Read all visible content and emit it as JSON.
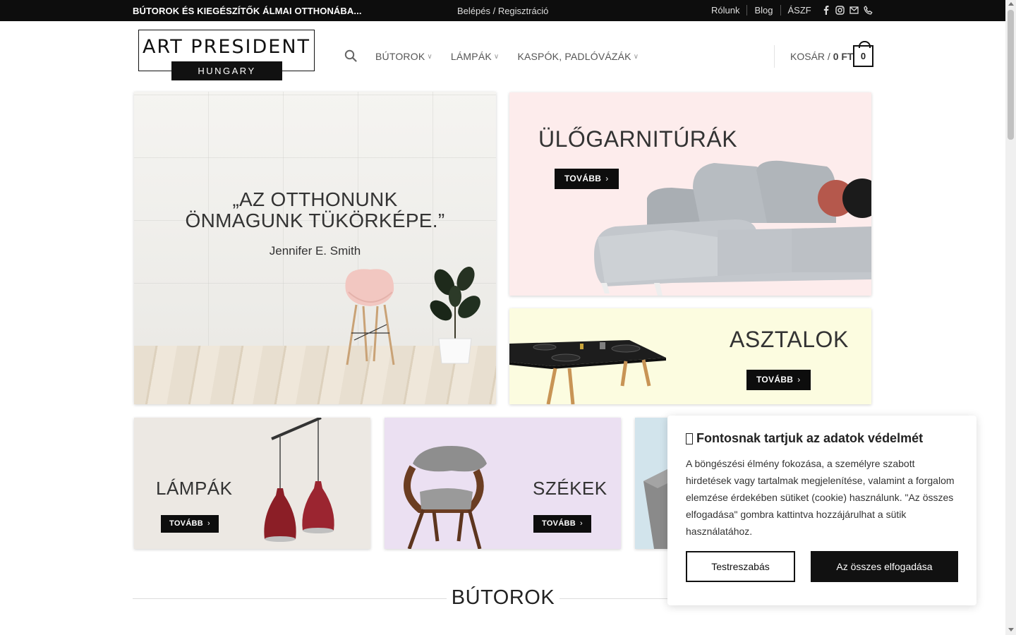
{
  "topbar": {
    "tagline": "BÚTOROK ÉS KIEGÉSZÍTŐK ÁLMAI OTTHONÁBA...",
    "login": "Belépés / Regisztráció",
    "links": [
      "Rólunk",
      "Blog",
      "ÁSZF"
    ],
    "social_icons": [
      "facebook-icon",
      "instagram-icon",
      "email-icon",
      "phone-icon"
    ]
  },
  "logo": {
    "line1": "ART PRESIDENT",
    "line2": "HUNGARY"
  },
  "nav": {
    "items": [
      "BÚTOROK",
      "LÁMPÁK",
      "KASPÓK, PADLÓVÁZÁK"
    ]
  },
  "cart": {
    "label": "KOSÁR /",
    "amount": "0 FT",
    "count": "0"
  },
  "hero": {
    "quote_line1": "„AZ OTTHONUNK",
    "quote_line2": "ÖNMAGUNK TÜKÖRKÉPE.”",
    "author": "Jennifer E. Smith"
  },
  "banners": {
    "ulogarniturak": {
      "title": "ÜLŐGARNITÚRÁK",
      "button": "TOVÁBB"
    },
    "asztalok": {
      "title": "ASZTALOK",
      "button": "TOVÁBB"
    },
    "lampak": {
      "title": "LÁMPÁK",
      "button": "TOVÁBB"
    },
    "szekek": {
      "title": "SZÉKEK",
      "button": "TOVÁBB"
    }
  },
  "section": {
    "title": "BÚTOROK"
  },
  "cookie": {
    "title": "Fontosnak tartjuk az adatok védelmét",
    "text": "A böngészési élmény fokozása, a személyre szabott hirdetések vagy tartalmak megjelenítése, valamint a forgalom elemzése érdekében sütiket (cookie) használunk. \"Az összes elfogadása\" gombra kattintva hozzájárulhat a sütik használatához.",
    "customize": "Testreszabás",
    "accept_all": "Az összes elfogadása"
  },
  "colors": {
    "topbar_bg": "#0d0d0d",
    "ulo_bg": "#fdecec",
    "asztal_bg": "#fcfce0",
    "lampak_bg": "#ece8e3",
    "szekek_bg": "#ebe0f2",
    "third_bg": "#d2e4ec"
  }
}
